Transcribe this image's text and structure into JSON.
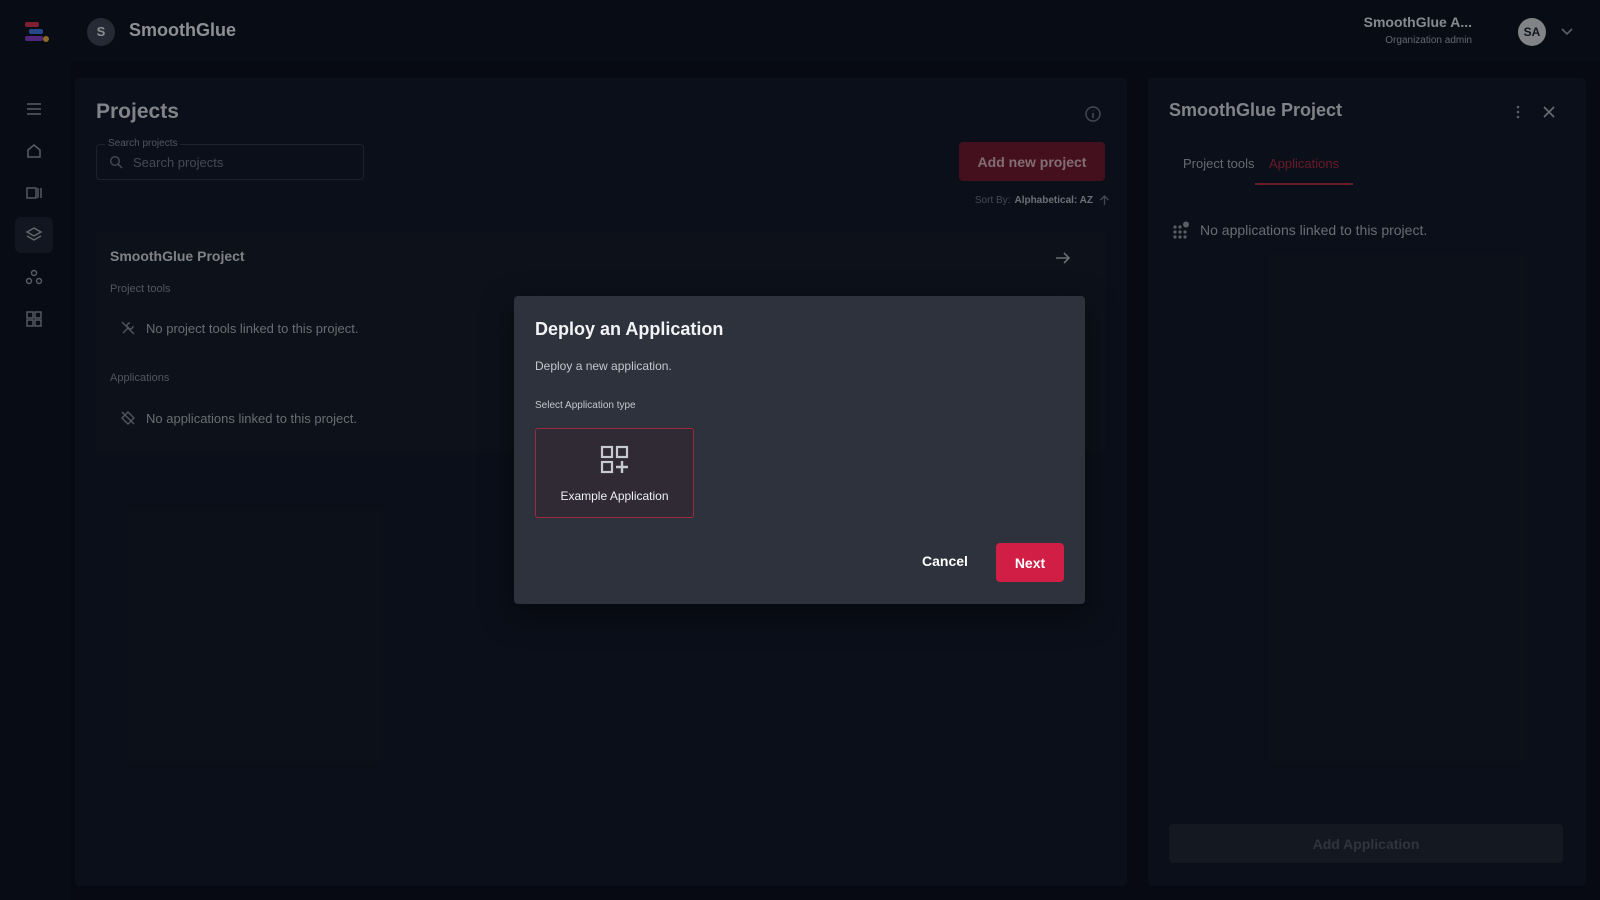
{
  "header": {
    "org_initial": "S",
    "org_name": "SmoothGlue",
    "user_name": "SmoothGlue A...",
    "user_role": "Organization admin",
    "user_initials": "SA"
  },
  "rail": {
    "items": [
      "menu-icon",
      "home-icon",
      "catalog-icon",
      "projects-icon",
      "teams-icon",
      "apps-icon"
    ],
    "active_index": 3
  },
  "projects": {
    "title": "Projects",
    "search": {
      "label": "Search projects",
      "placeholder": "Search projects"
    },
    "add_button": "Add new project",
    "sort": {
      "label": "Sort By:",
      "value": "Alphabetical: AZ"
    },
    "card": {
      "title": "SmoothGlue Project",
      "tools_label": "Project tools",
      "tools_empty": "No project tools linked to this project.",
      "apps_label": "Applications",
      "apps_empty": "No applications linked to this project."
    }
  },
  "side_panel": {
    "title": "SmoothGlue Project",
    "tabs": [
      {
        "label": "Project tools",
        "active": false
      },
      {
        "label": "Applications",
        "active": true
      }
    ],
    "empty_text": "No applications linked to this project.",
    "add_button": "Add Application"
  },
  "dialog": {
    "title": "Deploy an Application",
    "subtitle": "Deploy a new application.",
    "select_label": "Select Application type",
    "app_types": [
      {
        "label": "Example Application",
        "icon": "grid-plus-icon",
        "selected": true
      }
    ],
    "cancel": "Cancel",
    "next": "Next"
  },
  "colors": {
    "accent": "#d01e45",
    "accent_dim": "#6a1a2e",
    "background": "#0b101c",
    "panel": "#111827",
    "dialog": "#2d323c"
  }
}
